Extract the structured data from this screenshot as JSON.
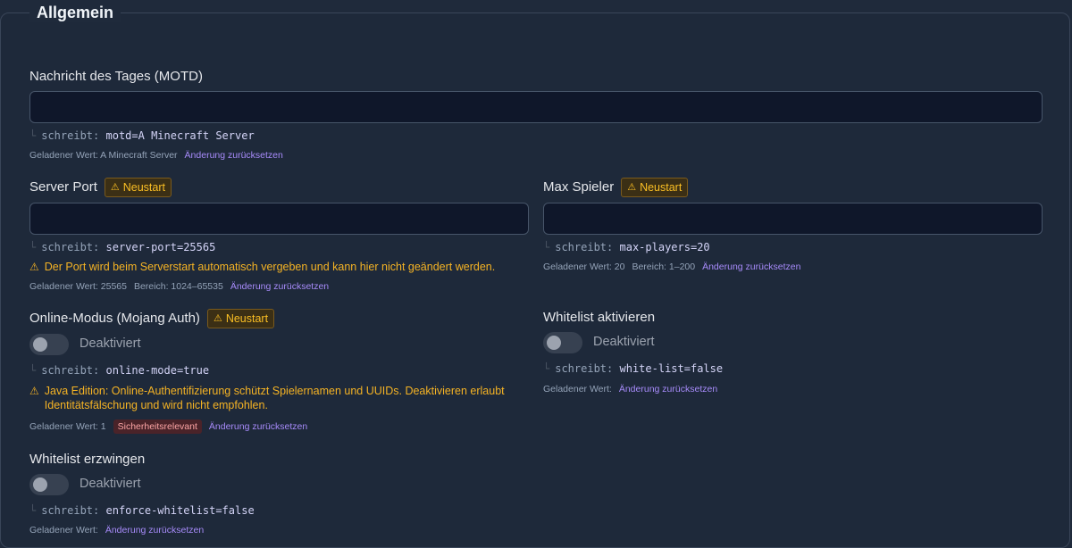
{
  "section_title": "Allgemein",
  "motd": {
    "label": "Nachricht des Tages (MOTD)",
    "value": "",
    "writes_prefix": "schreibt:",
    "writes_key": "motd=A Minecraft Server",
    "loaded": "Geladener Wert: A Minecraft Server",
    "reset": "Änderung zurücksetzen"
  },
  "server_port": {
    "label": "Server Port",
    "badge": "Neustart",
    "value": "",
    "writes_prefix": "schreibt:",
    "writes_key": "server-port=25565",
    "warning": "Der Port wird beim Serverstart automatisch vergeben und kann hier nicht geändert werden.",
    "loaded": "Geladener Wert: 25565",
    "range": "Bereich: 1024–65535",
    "reset": "Änderung zurücksetzen"
  },
  "max_players": {
    "label": "Max Spieler",
    "badge": "Neustart",
    "value": "",
    "writes_prefix": "schreibt:",
    "writes_key": "max-players=20",
    "loaded": "Geladener Wert: 20",
    "range": "Bereich: 1–200",
    "reset": "Änderung zurücksetzen"
  },
  "online_mode": {
    "label": "Online-Modus (Mojang Auth)",
    "badge": "Neustart",
    "toggle_label": "Deaktiviert",
    "writes_prefix": "schreibt:",
    "writes_key": "online-mode=true",
    "warning": "Java Edition: Online-Authentifizierung schützt Spielernamen und UUIDs. Deaktivieren erlaubt Identitätsfälschung und wird nicht empfohlen.",
    "loaded": "Geladener Wert: 1",
    "security": "Sicherheitsrelevant",
    "reset": "Änderung zurücksetzen"
  },
  "whitelist": {
    "label": "Whitelist aktivieren",
    "toggle_label": "Deaktiviert",
    "writes_prefix": "schreibt:",
    "writes_key": "white-list=false",
    "loaded": "Geladener Wert:",
    "reset": "Änderung zurücksetzen"
  },
  "enforce_whitelist": {
    "label": "Whitelist erzwingen",
    "toggle_label": "Deaktiviert",
    "writes_prefix": "schreibt:",
    "writes_key": "enforce-whitelist=false",
    "loaded": "Geladener Wert:",
    "reset": "Änderung zurücksetzen"
  }
}
